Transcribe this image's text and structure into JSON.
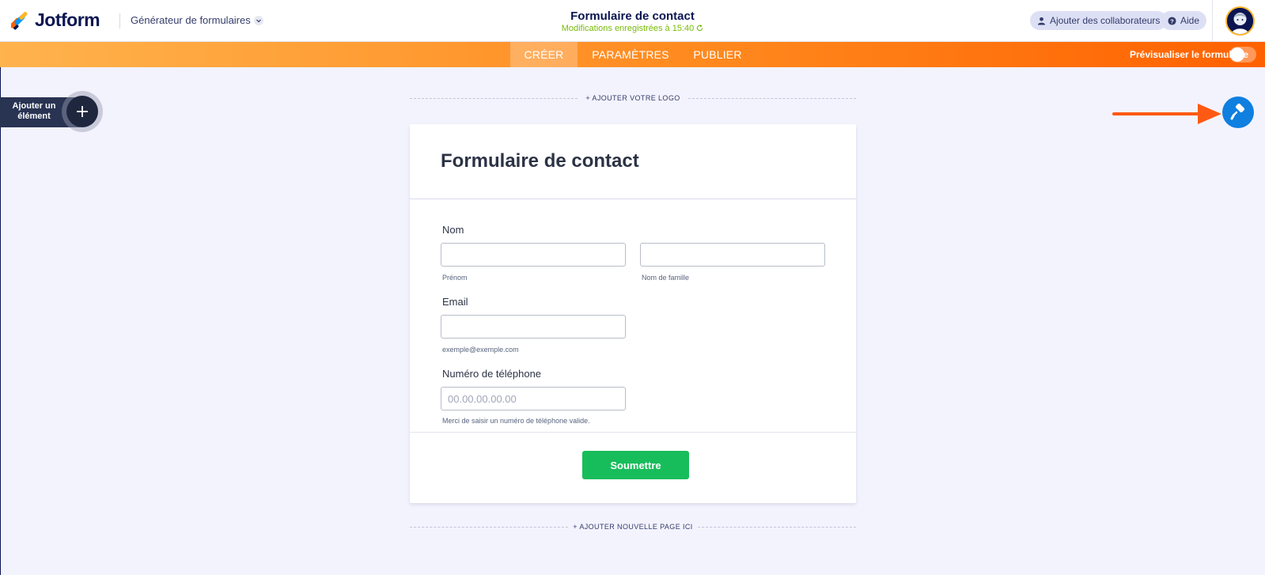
{
  "header": {
    "brand": "Jotform",
    "builder_menu": "Générateur de formulaires",
    "form_title": "Formulaire de contact",
    "save_status": "Modifications enregistrées à 15:40",
    "collaborators_label": "Ajouter des collaborateurs",
    "help_label": "Aide"
  },
  "nav": {
    "tabs": [
      {
        "label": "CRÉER",
        "active": true
      },
      {
        "label": "PARAMÈTRES",
        "active": false
      },
      {
        "label": "PUBLIER",
        "active": false
      }
    ],
    "preview_label": "Prévisualiser le formulaire",
    "preview_enabled": false
  },
  "sidebar": {
    "add_element_label": "Ajouter un élément"
  },
  "canvas": {
    "add_logo_label": "+ AJOUTER VOTRE LOGO",
    "add_page_label": "+ AJOUTER NOUVELLE PAGE ICI"
  },
  "form": {
    "heading": "Formulaire de contact",
    "name": {
      "label": "Nom",
      "first_value": "",
      "first_sublabel": "Prénom",
      "last_value": "",
      "last_sublabel": "Nom de famille"
    },
    "email": {
      "label": "Email",
      "value": "",
      "sublabel": "exemple@exemple.com"
    },
    "phone": {
      "label": "Numéro de téléphone",
      "value": "",
      "placeholder": "00.00.00.00.00",
      "sublabel": "Merci de saisir un numéro de téléphone valide."
    },
    "submit_label": "Soumettre"
  },
  "colors": {
    "brand_navy": "#0a1551",
    "nav_orange": "#ff6100",
    "submit_green": "#18bd5b",
    "designer_blue": "#0f7fe0",
    "status_green": "#78bb07",
    "annotation_arrow": "#ff5a14"
  },
  "icons": {
    "logo": "jotform-logo-icon",
    "dropdown": "chevron-down-icon",
    "collaborators": "user-icon",
    "help": "question-circle-icon",
    "refresh": "refresh-icon",
    "add": "plus-icon",
    "designer": "paint-roller-icon",
    "annotation": "arrow-right-icon"
  }
}
